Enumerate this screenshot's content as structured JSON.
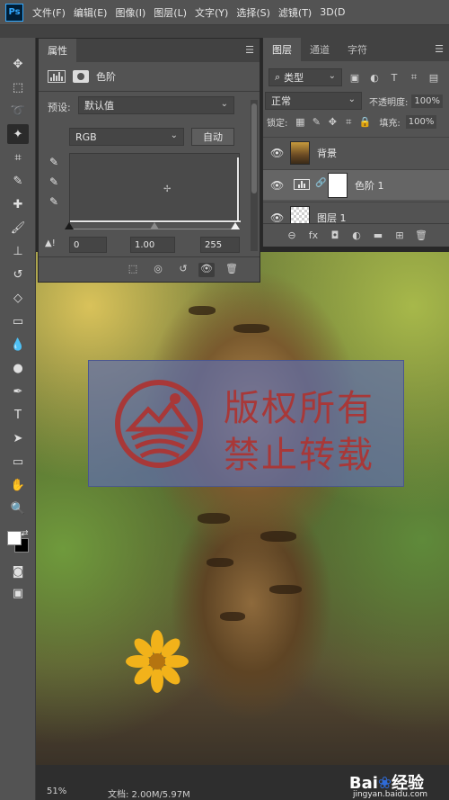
{
  "app": {
    "logo": "Ps"
  },
  "menu": [
    "文件(F)",
    "编辑(E)",
    "图像(I)",
    "图层(L)",
    "文字(Y)",
    "选择(S)",
    "滤镜(T)",
    "3D(D"
  ],
  "properties": {
    "tab_title": "属性",
    "adjustment_title": "色阶",
    "preset_label": "预设:",
    "preset_value": "默认值",
    "channel_value": "RGB",
    "auto_button": "自动",
    "input_black": "0",
    "input_gamma": "1.00",
    "input_white": "255"
  },
  "layers": {
    "tabs": [
      "图层",
      "通道",
      "字符"
    ],
    "filter_kind": "类型",
    "blend_mode": "正常",
    "opacity_label": "不透明度:",
    "opacity_value": "100%",
    "lock_label": "锁定:",
    "fill_label": "填充:",
    "fill_value": "100%",
    "items": [
      {
        "name": "背景"
      },
      {
        "name": "色阶 1"
      },
      {
        "name": "图层 1"
      }
    ]
  },
  "watermark": {
    "line1": "版权所有",
    "line2": "禁止转载"
  },
  "status": {
    "zoom": "51%",
    "doc": "文档: 2.00M/5.97M"
  },
  "baidu": {
    "brand": "Bai",
    "brand2": "经验",
    "url": "jingyan.baidu.com"
  },
  "colors": {
    "accent": "#31a8ff",
    "watermark_text": "#a83838",
    "watermark_bg": "#5f6eaa"
  }
}
